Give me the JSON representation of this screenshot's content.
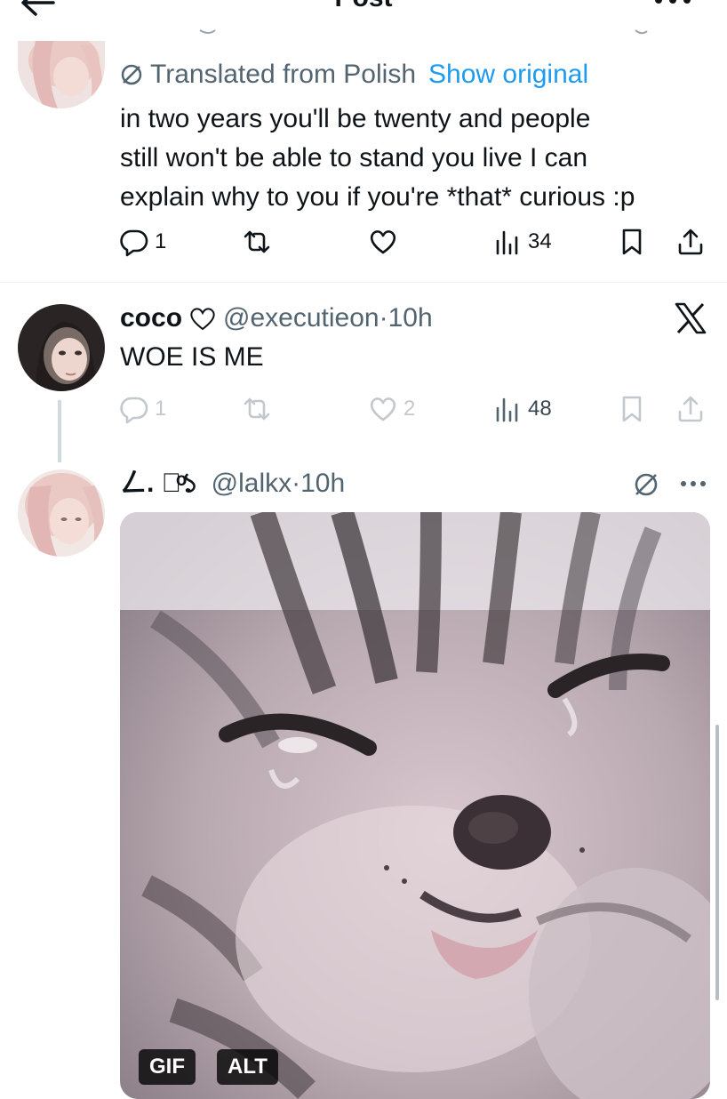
{
  "header": {
    "title": "Post"
  },
  "tweet1": {
    "translated_label": "Translated from Polish",
    "show_original_label": "Show original",
    "text": "in two years you'll be twenty and people\nstill won't be able to stand you live I can\nexplain why to you if you're *that* curious :p",
    "replies": "1",
    "reposts": "",
    "likes": "",
    "views": "34"
  },
  "tweet2": {
    "name": "coco",
    "handle": "@executieon",
    "time": "10h",
    "text": "WOE IS ME",
    "replies": "1",
    "reposts": "",
    "likes": "2",
    "views": "48"
  },
  "tweet3": {
    "name": "ㄥ. ⠐ͦ১",
    "handle": "@lalkx",
    "time": "10h",
    "media_badges": [
      "GIF",
      "ALT"
    ]
  },
  "colors": {
    "text": "#0f1419",
    "secondary": "#536471",
    "accent": "#1d9bf0",
    "divider": "#eff3f4"
  },
  "icons": [
    "back-arrow-icon",
    "more-icon",
    "translate-icon",
    "reply-icon",
    "repost-icon",
    "like-icon",
    "views-icon",
    "bookmark-icon",
    "share-icon",
    "x-logo-icon",
    "heart-emoji-icon"
  ]
}
